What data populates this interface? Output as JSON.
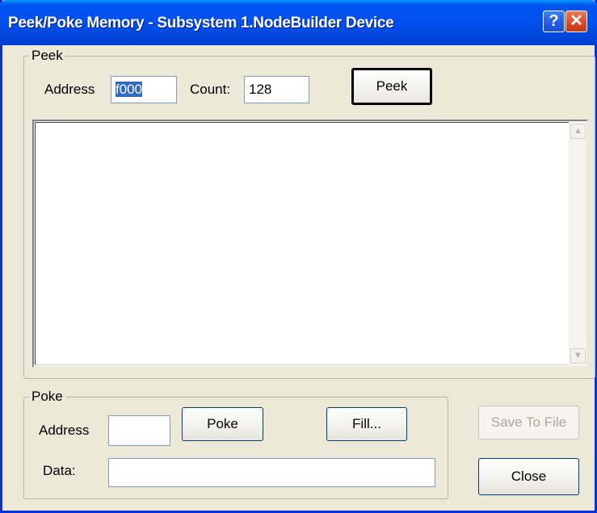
{
  "window": {
    "title": "Peek/Poke Memory - Subsystem 1.NodeBuilder Device",
    "help_glyph": "?",
    "close_glyph": "✕"
  },
  "peek": {
    "group_label": "Peek",
    "address_label": "Address",
    "address_value": "f000",
    "count_label": "Count:",
    "count_value": "128",
    "peek_button": "Peek",
    "output_text": ""
  },
  "poke": {
    "group_label": "Poke",
    "address_label": "Address",
    "address_value": "",
    "poke_button": "Poke",
    "fill_button": "Fill...",
    "data_label": "Data:",
    "data_value": ""
  },
  "buttons": {
    "save_to_file": "Save To File",
    "close": "Close"
  },
  "scrollbar": {
    "up_icon": "scroll-up-arrow-icon",
    "down_icon": "scroll-down-arrow-icon"
  },
  "colors": {
    "titlebar": "#0054e3",
    "dialog_bg": "#ece9d8",
    "selection": "#316ac5"
  }
}
